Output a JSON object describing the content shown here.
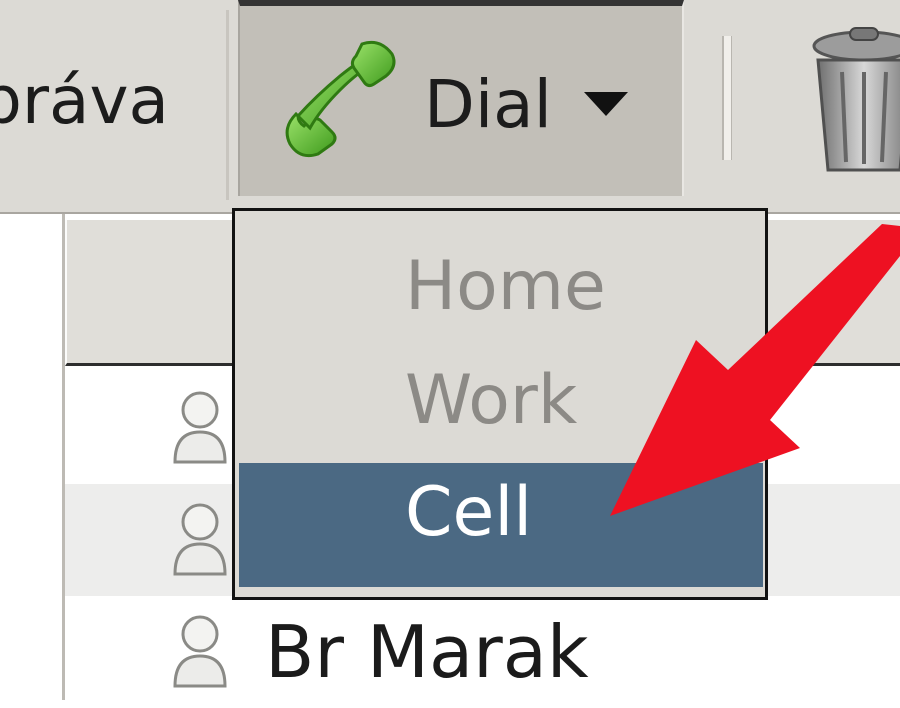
{
  "toolbar": {
    "zprava_label": "práva",
    "dial_label": "Dial",
    "icons": {
      "dial": "phone-icon",
      "dropdown": "dropdown-arrow-icon",
      "delete": "trash-icon"
    }
  },
  "dial_menu": {
    "items": [
      {
        "label": "Home",
        "state": "disabled"
      },
      {
        "label": "Work",
        "state": "disabled"
      },
      {
        "label": "Cell",
        "state": "highlighted"
      }
    ]
  },
  "contacts": {
    "rows": [
      {
        "name": "",
        "icon": "contact-icon"
      },
      {
        "name": "",
        "icon": "contact-icon"
      },
      {
        "name": "Br Marak",
        "icon": "contact-icon"
      }
    ]
  },
  "colors": {
    "highlight": "#4b6983",
    "annotation_arrow": "#ee1122",
    "phone": "#5cbf2a"
  }
}
